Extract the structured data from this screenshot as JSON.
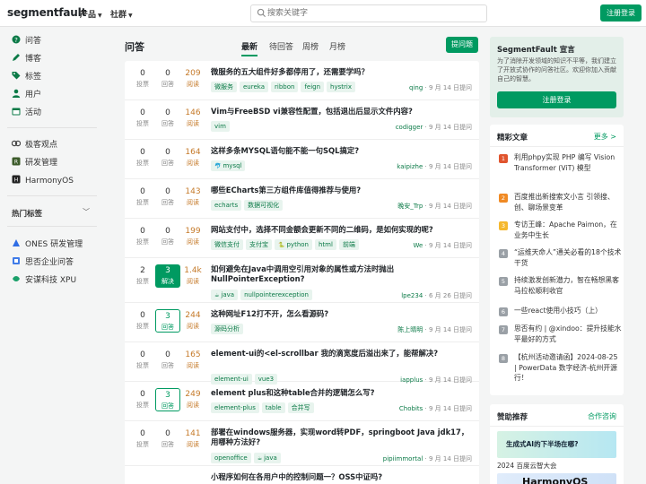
{
  "header": {
    "logo": "segmentfault",
    "nav": [
      {
        "label": "产品"
      },
      {
        "label": "社群"
      }
    ],
    "search_placeholder": "搜索关键字",
    "login_label": "注册登录"
  },
  "sidebar": {
    "items": [
      {
        "label": "问答",
        "icon": "question-icon"
      },
      {
        "label": "博客",
        "icon": "blog-icon"
      },
      {
        "label": "标签",
        "icon": "tag-icon"
      },
      {
        "label": "用户",
        "icon": "user-icon"
      },
      {
        "label": "活动",
        "icon": "calendar-icon"
      }
    ],
    "groups": [
      {
        "label": "极客观点"
      },
      {
        "label": "研发管理"
      },
      {
        "label": "HarmonyOS"
      }
    ],
    "hot_tags_label": "热门标签",
    "partners": [
      {
        "label": "ONES 研发管理"
      },
      {
        "label": "思否企业问答"
      },
      {
        "label": "安谋科技 XPU"
      }
    ]
  },
  "main": {
    "title": "问答",
    "tabs": [
      {
        "label": "最新",
        "active": true
      },
      {
        "label": "待回答",
        "active": false
      },
      {
        "label": "周榜",
        "active": false
      },
      {
        "label": "月榜",
        "active": false
      }
    ],
    "ask_label": "提问题",
    "votes_label": "投票",
    "answers_label": "回答",
    "solved_label": "解决",
    "views_label": "阅读",
    "questions": [
      {
        "votes": "0",
        "answers": "0",
        "views": "209",
        "title": "微服务的五大组件好多都停用了，还需要学吗？",
        "tags": [
          "微服务",
          "eureka",
          "ribbon",
          "feign",
          "hystrix"
        ],
        "author": "qing",
        "time": " · 9 月 14 日提问",
        "state": "none"
      },
      {
        "votes": "0",
        "answers": "0",
        "views": "146",
        "title": "Vim与FreeBSD vi兼容性配置，包括退出后显示文件内容?",
        "tags": [
          "vim"
        ],
        "author": "codigger",
        "time": " · 9 月 14 日提问",
        "state": "none"
      },
      {
        "votes": "0",
        "answers": "0",
        "views": "164",
        "title": "这样多条MYSQL语句能不能一句SQL搞定?",
        "tags": [
          "mysql"
        ],
        "author": "kaipizhe",
        "time": " · 9 月 14 日提问",
        "state": "none"
      },
      {
        "votes": "0",
        "answers": "0",
        "views": "143",
        "title": "哪些ECharts第三方组件库值得推荐与使用?",
        "tags": [
          "echarts",
          "数据可视化"
        ],
        "author": "晚安_Trp",
        "time": " · 9 月 14 日提问",
        "state": "none"
      },
      {
        "votes": "0",
        "answers": "0",
        "views": "199",
        "title": "网站支付中，选择不同金额会更新不同的二维码，是如何实现的呢?",
        "tags": [
          "微信支付",
          "支付宝",
          "python",
          "html",
          "前端"
        ],
        "author": "We",
        "time": " · 9 月 14 日提问",
        "state": "none"
      },
      {
        "votes": "2",
        "answers": "3",
        "views": "1.4k",
        "title": "如何避免在Java中调用空引用对象的属性或方法时抛出NullPointerException?",
        "tags": [
          "java",
          "nullpointerexception"
        ],
        "author": "lpe234",
        "time": " · 6 月 26 日提问",
        "state": "solved"
      },
      {
        "votes": "0",
        "answers": "3",
        "views": "244",
        "title": "这种网址F12打不开，怎么看源码?",
        "tags": [
          "源码分析"
        ],
        "author": "陈上晴明",
        "time": " · 9 月 14 日提问",
        "state": "answered"
      },
      {
        "votes": "0",
        "answers": "0",
        "views": "165",
        "title": "element-ui的<el-scrollbar 我的滴宽度后溢出来了，能帮解决?",
        "tags": [
          "element-ui",
          "vue3"
        ],
        "author": "iapplus",
        "time": " · 9 月 14 日提问",
        "state": "none"
      },
      {
        "votes": "0",
        "answers": "3",
        "views": "249",
        "title": "element plus和这种table合并的逻辑怎么写?",
        "tags": [
          "element-plus",
          "table",
          "合并写"
        ],
        "author": "Chobits",
        "time": " · 9 月 14 日提问",
        "state": "answered"
      },
      {
        "votes": "0",
        "answers": "0",
        "views": "141",
        "title": "部署在windows服务器，实现word转PDF，springboot Java jdk17，用哪种方法好?",
        "tags": [
          "openoffice",
          "java"
        ],
        "author": "pipiimmortal",
        "time": " · 9 月 14 日提问",
        "state": "none"
      },
      {
        "votes": "",
        "answers": "",
        "views": "",
        "title": "小程序如何在各用户中的控制问题一？OSS中证吗?",
        "tags": [],
        "author": "",
        "time": "",
        "state": "none"
      }
    ]
  },
  "right": {
    "promo": {
      "title": "SegmentFault 宣言",
      "text": "为了消除开发领域的知识不平等，我们建立了开放式协作的问答社区。欢迎你加入贡献自己的智慧。",
      "button": "注册登录"
    },
    "articles": {
      "title": "精彩文章",
      "more": "更多 >",
      "items": [
        {
          "rank": "1",
          "color": "#e0542e",
          "text": "利用phpy实现 PHP 编写 Vision Transformer (ViT) 模型"
        },
        {
          "rank": "2",
          "color": "#f08a24",
          "text": "百度推出新搜索文小言 引领搜、创、聊场景变革"
        },
        {
          "rank": "3",
          "color": "#f5b82e",
          "text": "专访王峰：Apache Paimon，在业务中生长"
        },
        {
          "rank": "4",
          "color": "#9aa0a6",
          "text": "“运维天命人”通关必看的18个技术干货"
        },
        {
          "rank": "5",
          "color": "#9aa0a6",
          "text": "持续激发创新潜力，智在畅想黑客马拉松顺利收官"
        },
        {
          "rank": "6",
          "color": "#9aa0a6",
          "text": "一些react使用小技巧（上）"
        },
        {
          "rank": "7",
          "color": "#9aa0a6",
          "text": "思否有约 | @xindoo：提升技能水平最好的方式"
        },
        {
          "rank": "8",
          "color": "#9aa0a6",
          "text": "【杭州活动邀请函】2024-08-25 | PowerData 数字经济-杭州开源行！"
        }
      ]
    },
    "sponsor": {
      "title": "赞助推荐",
      "cooperate": "合作咨询",
      "banner1": "生成式AI的下半场在哪?",
      "caption": "2024 百度云智大会",
      "banner2": "HarmonyOS"
    }
  }
}
